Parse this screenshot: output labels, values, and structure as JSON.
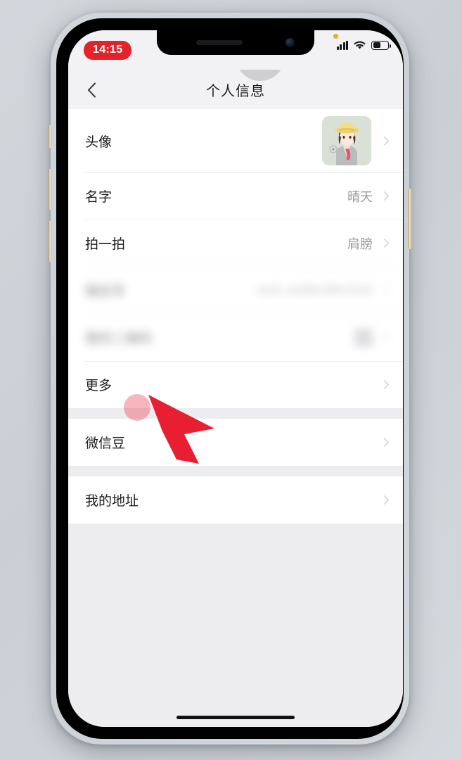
{
  "device": {
    "frame_color": "#d8c7a0",
    "outer_background": "#ccd2d8"
  },
  "status_bar": {
    "recording_time": "14:15",
    "recording_pill_color": "#e2232b",
    "mic_indicator": "mic-active-dot",
    "mic_indicator_color": "#f0a92b",
    "signal_icon": "cellular-signal-icon",
    "signal_bars": 4,
    "wifi_icon": "wifi-icon",
    "battery_icon": "battery-icon",
    "battery_level_percent": 55
  },
  "nav": {
    "back_icon": "back-chevron-icon",
    "title": "个人信息",
    "touch_indicator": "assistive-touch-circle"
  },
  "list": {
    "sections": [
      {
        "rows": [
          {
            "label": "头像",
            "value": "",
            "kind": "avatar",
            "blurred": false,
            "icon": "avatar-thumbnail"
          },
          {
            "label": "名字",
            "value": "晴天",
            "kind": "text",
            "blurred": false
          },
          {
            "label": "拍一拍",
            "value": "肩膀",
            "kind": "text",
            "blurred": false
          },
          {
            "label": "微信号",
            "value": "wxid_cav8bn28hn7b12",
            "kind": "text",
            "blurred": true
          },
          {
            "label": "我的二维码",
            "value": "",
            "kind": "qr",
            "blurred": true,
            "icon": "qr-code-icon"
          },
          {
            "label": "更多",
            "value": "",
            "kind": "text",
            "blurred": false
          }
        ]
      },
      {
        "rows": [
          {
            "label": "微信豆",
            "value": "",
            "kind": "text",
            "blurred": false
          }
        ]
      },
      {
        "rows": [
          {
            "label": "我的地址",
            "value": "",
            "kind": "text",
            "blurred": false
          }
        ]
      }
    ],
    "chevron_icon": "chevron-right-icon"
  },
  "cursor": {
    "icon": "red-arrow-cursor",
    "color": "#e81f32",
    "tap_ripple_color": "rgba(237,50,70,0.36)",
    "target_row_label": "更多"
  },
  "home_indicator": "home-indicator-bar"
}
